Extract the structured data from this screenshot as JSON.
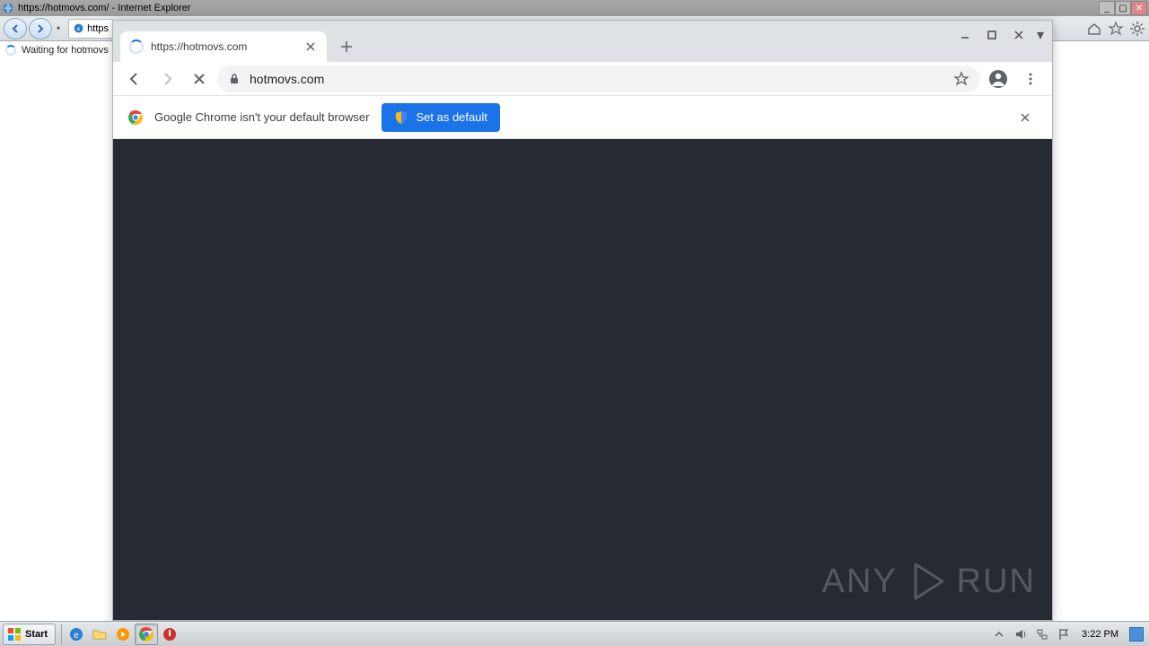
{
  "ie": {
    "title": "https://hotmovs.com/ - Internet Explorer",
    "address_fragment": "https",
    "status_text": "Waiting for hotmovs"
  },
  "chrome": {
    "tab": {
      "title": "https://hotmovs.com"
    },
    "omnibox": {
      "url_display": "hotmovs.com"
    },
    "infobar": {
      "message": "Google Chrome isn't your default browser",
      "button_label": "Set as default"
    }
  },
  "watermark": {
    "left": "ANY",
    "right": "RUN"
  },
  "taskbar": {
    "start_label": "Start",
    "clock": "3:22 PM"
  }
}
